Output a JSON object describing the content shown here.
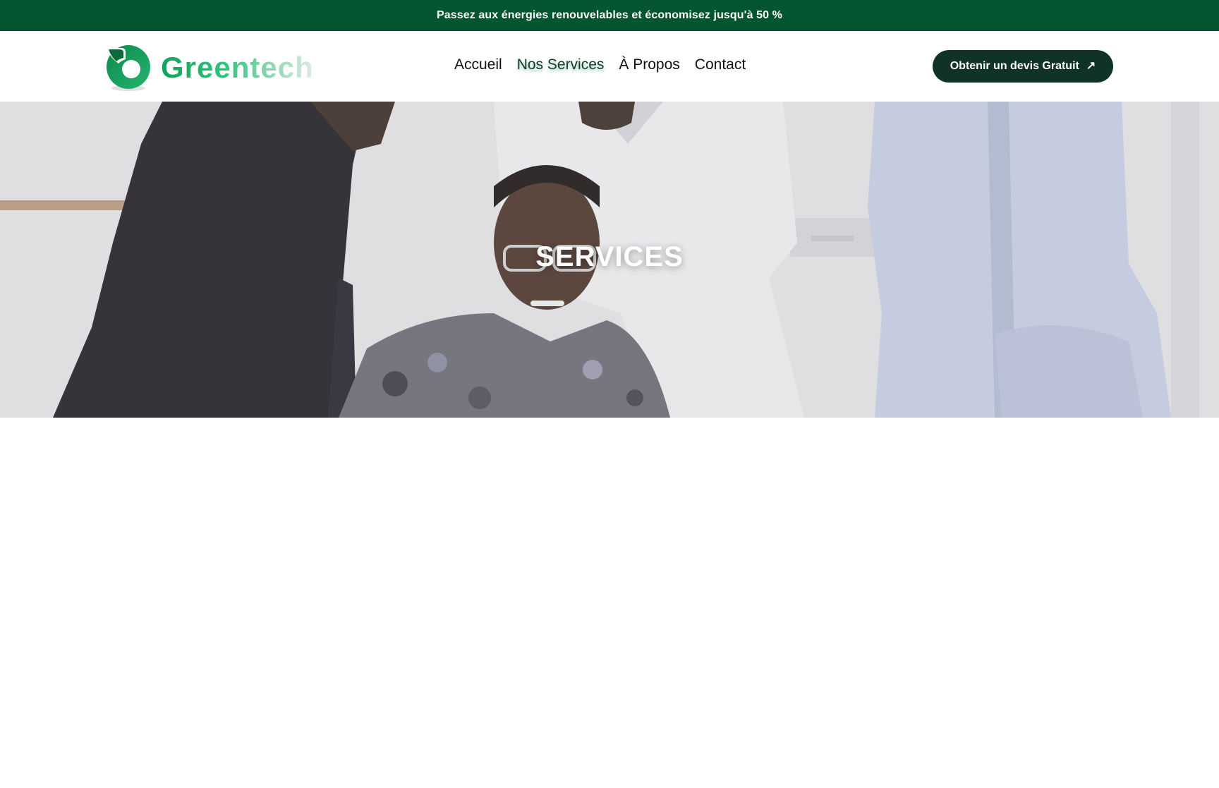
{
  "banner": {
    "text": "Passez aux énergies renouvelables et économisez jusqu'à 50 %"
  },
  "brand": {
    "name": "Greentech",
    "logo_icon": "leaf-drop-logo-icon",
    "colors": {
      "primary": "#12a35b",
      "dark": "#0f3324",
      "banner": "#02552e"
    }
  },
  "nav": {
    "items": [
      {
        "label": "Accueil",
        "active": false
      },
      {
        "label": "Nos Services",
        "active": true
      },
      {
        "label": "À Propos",
        "active": false
      },
      {
        "label": "Contact",
        "active": false
      }
    ]
  },
  "cta": {
    "label": "Obtenir un devis Gratuit",
    "icon": "arrow-up-right-icon"
  },
  "hero": {
    "title": "SERVICES",
    "image": "team-working-photo"
  }
}
